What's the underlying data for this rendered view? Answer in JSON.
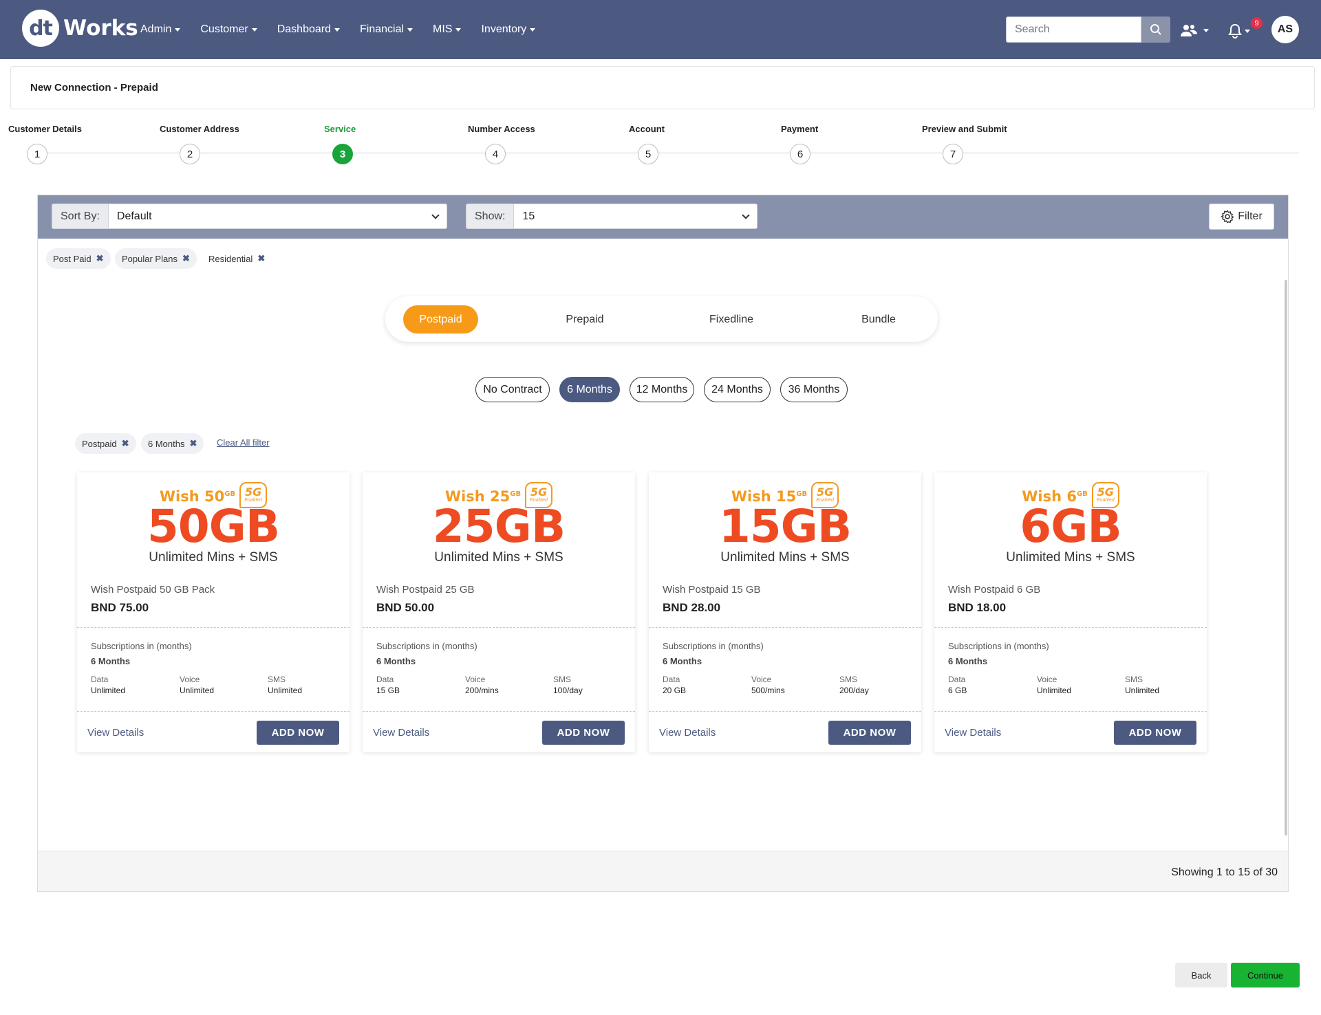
{
  "header": {
    "logo_mark": "dt",
    "logo_text": "Works",
    "nav": [
      "Admin",
      "Customer",
      "Dashboard",
      "Financial",
      "MIS",
      "Inventory"
    ],
    "search_placeholder": "Search",
    "notification_count": "9",
    "avatar_initials": "AS"
  },
  "page": {
    "title": "New Connection - Prepaid"
  },
  "stepper": {
    "steps": [
      {
        "label": "Customer Details",
        "num": "1"
      },
      {
        "label": "Customer Address",
        "num": "2"
      },
      {
        "label": "Service",
        "num": "3"
      },
      {
        "label": "Number Access",
        "num": "4"
      },
      {
        "label": "Account",
        "num": "5"
      },
      {
        "label": "Payment",
        "num": "6"
      },
      {
        "label": "Preview and Submit",
        "num": "7"
      }
    ],
    "active_step": "3"
  },
  "toolbar": {
    "sort_label": "Sort By:",
    "sort_value": "Default",
    "show_label": "Show:",
    "show_value": "15",
    "filter_label": "Filter"
  },
  "top_chips": [
    "Post Paid",
    "Popular Plans",
    "Residential"
  ],
  "plan_types": {
    "items": [
      "Postpaid",
      "Prepaid",
      "Fixedline",
      "Bundle"
    ],
    "active": "Postpaid"
  },
  "durations": {
    "items": [
      "No Contract",
      "6 Months",
      "12 Months",
      "24 Months",
      "36 Months"
    ],
    "active": "6 Months"
  },
  "active_filters": [
    "Postpaid",
    "6 Months"
  ],
  "clear_all_label": "Clear All filter",
  "plans": [
    {
      "badge_name": "Wish 50",
      "badge_sup": "GB",
      "fiveg": "5G",
      "fiveg_sub": "Enabled",
      "size": "50GB",
      "tagline": "Unlimited Mins + SMS",
      "name": "Wish Postpaid 50 GB Pack",
      "price": "BND 75.00",
      "sub_label": "Subscriptions in (months)",
      "sub_value": "6 Months",
      "data_label": "Data",
      "data": "Unlimited",
      "voice_label": "Voice",
      "voice": "Unlimited",
      "sms_label": "SMS",
      "sms": "Unlimited",
      "view": "View Details",
      "add": "ADD NOW"
    },
    {
      "badge_name": "Wish 25",
      "badge_sup": "GB",
      "fiveg": "5G",
      "fiveg_sub": "Enabled",
      "size": "25GB",
      "tagline": "Unlimited Mins + SMS",
      "name": "Wish Postpaid 25 GB",
      "price": "BND 50.00",
      "sub_label": "Subscriptions in (months)",
      "sub_value": "6 Months",
      "data_label": "Data",
      "data": "15 GB",
      "voice_label": "Voice",
      "voice": "200/mins",
      "sms_label": "SMS",
      "sms": "100/day",
      "view": "View Details",
      "add": "ADD NOW"
    },
    {
      "badge_name": "Wish 15",
      "badge_sup": "GB",
      "fiveg": "5G",
      "fiveg_sub": "Enabled",
      "size": "15GB",
      "tagline": "Unlimited Mins + SMS",
      "name": "Wish Postpaid 15 GB",
      "price": "BND 28.00",
      "sub_label": "Subscriptions in (months)",
      "sub_value": "6 Months",
      "data_label": "Data",
      "data": "20 GB",
      "voice_label": "Voice",
      "voice": "500/mins",
      "sms_label": "SMS",
      "sms": "200/day",
      "view": "View Details",
      "add": "ADD NOW"
    },
    {
      "badge_name": "Wish 6",
      "badge_sup": "GB",
      "fiveg": "5G",
      "fiveg_sub": "Enabled",
      "size": "6GB",
      "tagline": "Unlimited Mins + SMS",
      "name": "Wish Postpaid 6 GB",
      "price": "BND 18.00",
      "sub_label": "Subscriptions in (months)",
      "sub_value": "6 Months",
      "data_label": "Data",
      "data": "6 GB",
      "voice_label": "Voice",
      "voice": "Unlimited",
      "sms_label": "SMS",
      "sms": "Unlimited",
      "view": "View Details",
      "add": "ADD NOW"
    }
  ],
  "pagination": {
    "showing": "Showing 1 to 15 of 30"
  },
  "actions": {
    "back": "Back",
    "continue": "Continue"
  },
  "colors": {
    "nav_bg": "#4c5a82",
    "accent_orange": "#f79a17",
    "plan_red": "#ee4b23",
    "success_green": "#17a53a"
  }
}
